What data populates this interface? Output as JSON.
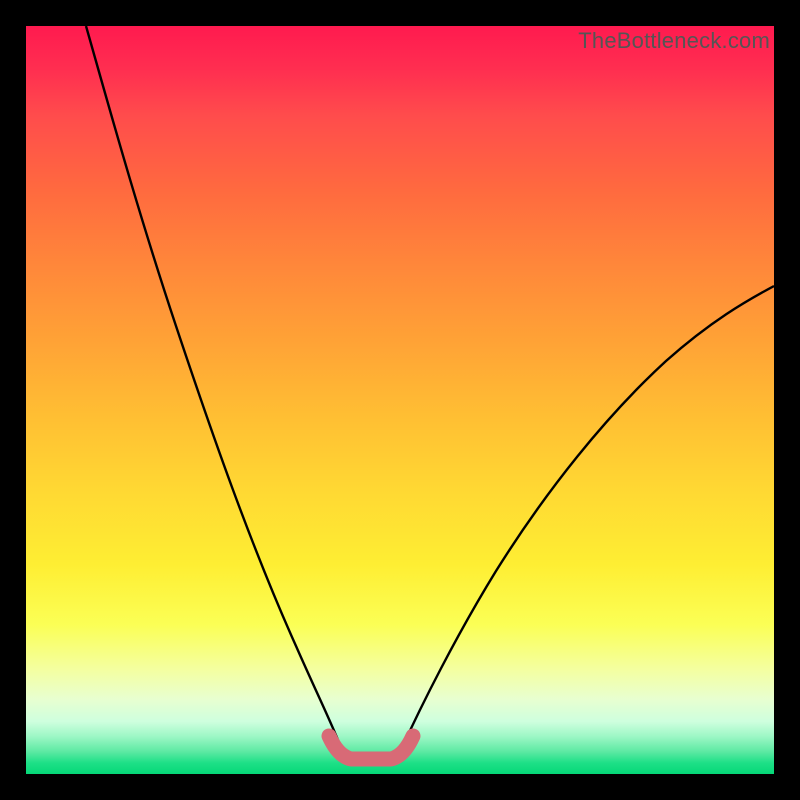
{
  "watermark": "TheBottleneck.com",
  "chart_data": {
    "type": "line",
    "title": "",
    "xlabel": "",
    "ylabel": "",
    "xlim": [
      0,
      100
    ],
    "ylim": [
      0,
      100
    ],
    "series": [
      {
        "name": "left-curve",
        "x": [
          8,
          12,
          16,
          20,
          24,
          28,
          32,
          36,
          40,
          42
        ],
        "y": [
          100,
          82,
          66,
          52,
          40,
          30,
          21,
          13,
          6,
          3
        ]
      },
      {
        "name": "right-curve",
        "x": [
          50,
          54,
          58,
          62,
          66,
          72,
          78,
          84,
          90,
          96,
          100
        ],
        "y": [
          3,
          7,
          12,
          18,
          24,
          32,
          40,
          48,
          55,
          61,
          65
        ]
      },
      {
        "name": "bottom-segment",
        "x": [
          40.5,
          42,
          44,
          46,
          48,
          50,
          51.5
        ],
        "y": [
          5,
          2.5,
          1.5,
          1.5,
          1.5,
          2.5,
          5
        ],
        "color": "#d86a76",
        "stroke_width": 14,
        "linecap": "round"
      }
    ],
    "background_gradient": {
      "direction": "vertical",
      "stops": [
        {
          "pos": 0.0,
          "color": "#ff1a4f"
        },
        {
          "pos": 0.5,
          "color": "#ffc933"
        },
        {
          "pos": 0.85,
          "color": "#f8ff80"
        },
        {
          "pos": 1.0,
          "color": "#05d878"
        }
      ]
    }
  }
}
